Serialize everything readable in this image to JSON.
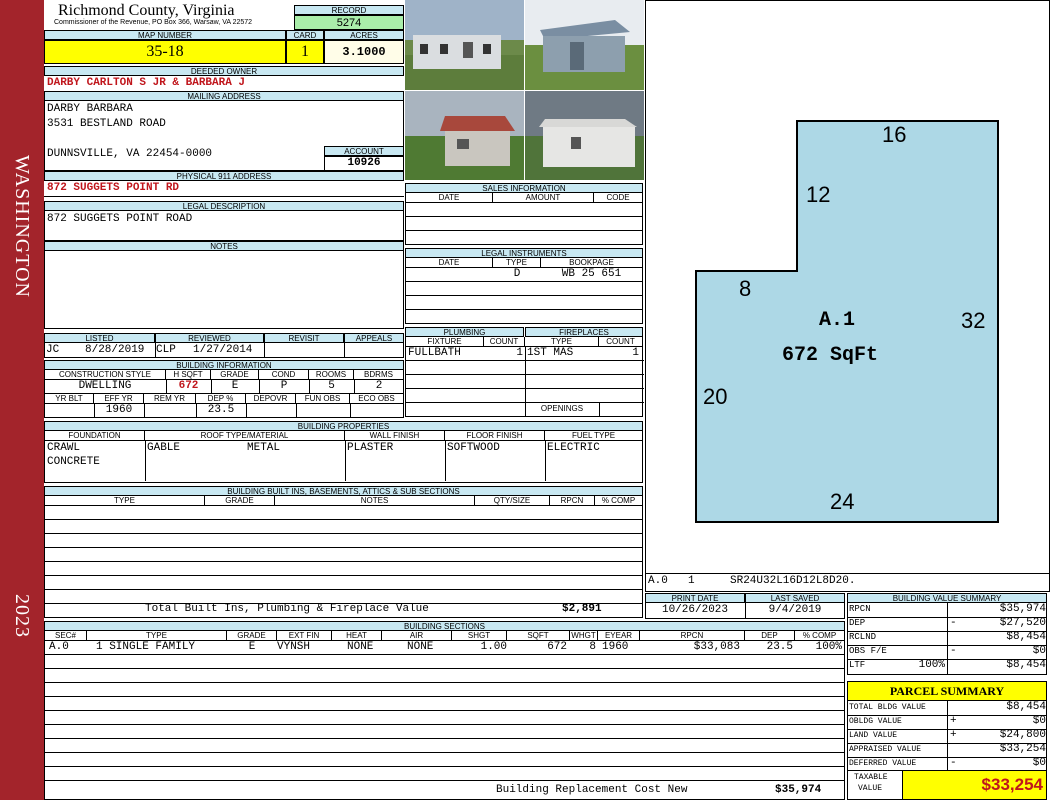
{
  "sidebar": {
    "top_text": "WASHINGTON",
    "bottom_text": "2023"
  },
  "header": {
    "county": "Richmond County, Virginia",
    "commissioner": "Commissioner of the Revenue, PO Box 366, Warsaw, VA 22572",
    "record_label": "RECORD",
    "record": "5274",
    "map_label": "MAP NUMBER",
    "map_number": "35-18",
    "card_label": "CARD",
    "card": "1",
    "acres_label": "ACRES",
    "acres": "3.1000"
  },
  "owner": {
    "deeded_label": "DEEDED OWNER",
    "deeded": "DARBY CARLTON S JR & BARBARA J",
    "mailing_label": "MAILING ADDRESS",
    "mailing_lines": [
      "DARBY BARBARA",
      "3531 BESTLAND ROAD",
      "",
      "DUNNSVILLE, VA 22454-0000"
    ],
    "account_label": "ACCOUNT",
    "account": "10926",
    "physical_label": "PHYSICAL 911 ADDRESS",
    "physical": "872 SUGGETS POINT RD",
    "legal_label": "LEGAL DESCRIPTION",
    "legal": "872 SUGGETS POINT ROAD",
    "notes_label": "NOTES"
  },
  "review": {
    "listed_label": "LISTED",
    "listed_by": "JC",
    "listed_date": "8/28/2019",
    "reviewed_label": "REVIEWED",
    "reviewed_by": "CLP",
    "reviewed_date": "1/27/2014",
    "revisit_label": "REVISIT",
    "appeals_label": "APPEALS"
  },
  "building_info": {
    "label": "BUILDING INFORMATION",
    "headers": [
      "CONSTRUCTION STYLE",
      "H SQFT",
      "GRADE",
      "COND",
      "ROOMS",
      "BDRMS"
    ],
    "values": [
      "DWELLING",
      "672",
      "E",
      "P",
      "5",
      "2"
    ],
    "headers2": [
      "YR BLT",
      "EFF YR",
      "REM YR",
      "DEP %",
      "DEPOVR",
      "FUN OBS",
      "ECO OBS"
    ],
    "values2": [
      "",
      "1960",
      "",
      "23.5",
      "",
      "",
      ""
    ]
  },
  "sales": {
    "label": "SALES INFORMATION",
    "headers": [
      "DATE",
      "AMOUNT",
      "CODE"
    ]
  },
  "legal_instruments": {
    "label": "LEGAL INSTRUMENTS",
    "headers": [
      "DATE",
      "TYPE",
      "BOOKPAGE"
    ],
    "rows": [
      [
        "",
        "D",
        "WB 25 651"
      ]
    ]
  },
  "plumbing": {
    "label": "PLUMBING",
    "headers": [
      "FIXTURE",
      "COUNT"
    ],
    "rows": [
      [
        "FULLBATH",
        "1"
      ]
    ]
  },
  "fireplaces": {
    "label": "FIREPLACES",
    "headers": [
      "TYPE",
      "COUNT"
    ],
    "rows": [
      [
        "1ST MAS",
        "1"
      ]
    ],
    "openings_label": "OPENINGS"
  },
  "properties": {
    "label": "BUILDING PROPERTIES",
    "headers": [
      "FOUNDATION",
      "ROOF TYPE/MATERIAL",
      "WALL FINISH",
      "FLOOR FINISH",
      "FUEL TYPE"
    ],
    "foundation": [
      "CRAWL",
      "CONCRETE"
    ],
    "roof_type": "GABLE",
    "roof_material": "METAL",
    "wall": "PLASTER",
    "floor": "SOFTWOOD",
    "fuel": "ELECTRIC"
  },
  "builtins": {
    "label": "BUILDING BUILT INS, BASEMENTS, ATTICS & SUB SECTIONS",
    "headers": [
      "TYPE",
      "GRADE",
      "NOTES",
      "QTY/SIZE",
      "RPCN",
      "% COMP"
    ],
    "total_label": "Total Built Ins, Plumbing & Fireplace Value",
    "total": "$2,891"
  },
  "sketch": {
    "labels": [
      "16",
      "12",
      "8",
      "32",
      "20",
      "24"
    ],
    "section": "A.1",
    "area": "672 SqFt",
    "footer_sec": "A.0",
    "footer_card": "1",
    "footer_code": "SR24U32L16D12L8D20."
  },
  "dates": {
    "print_label": "PRINT DATE",
    "print": "10/26/2023",
    "saved_label": "LAST SAVED",
    "saved": "9/4/2019"
  },
  "sections": {
    "label": "BUILDING SECTIONS",
    "headers": [
      "SEC#",
      "TYPE",
      "GRADE",
      "EXT FIN",
      "HEAT",
      "AIR",
      "SHGT",
      "SQFT",
      "WHGT",
      "EYEAR",
      "RPCN",
      "DEP",
      "% COMP"
    ],
    "row": [
      "A.0",
      "1 SINGLE FAMILY",
      "E",
      "VYNSH",
      "NONE",
      "NONE",
      "1.00",
      "672",
      "8",
      "1960",
      "$33,083",
      "23.5",
      "100%"
    ],
    "replacement_label": "Building Replacement Cost New",
    "replacement": "$35,974"
  },
  "value_summary": {
    "label": "BUILDING VALUE SUMMARY",
    "rows": [
      {
        "label": "RPCN",
        "sign": "",
        "value": "$35,974"
      },
      {
        "label": "DEP",
        "sign": "-",
        "value": "$27,520"
      },
      {
        "label": "RCLND",
        "sign": "",
        "value": "$8,454"
      },
      {
        "label": "OBS F/E",
        "sign": "-",
        "value": "$0"
      },
      {
        "label": "LTF",
        "sign": "100%",
        "value": "$8,454"
      }
    ]
  },
  "parcel": {
    "label": "PARCEL SUMMARY",
    "rows": [
      {
        "label": "TOTAL BLDG VALUE",
        "sign": "",
        "value": "$8,454"
      },
      {
        "label": "OBLDG VALUE",
        "sign": "+",
        "value": "$0"
      },
      {
        "label": "LAND VALUE",
        "sign": "+",
        "value": "$24,800"
      },
      {
        "label": "APPRAISED VALUE",
        "sign": "",
        "value": "$33,254"
      },
      {
        "label": "DEFERRED VALUE",
        "sign": "-",
        "value": "$0"
      }
    ],
    "taxable_label_1": "TAXABLE",
    "taxable_label_2": "VALUE",
    "taxable": "$33,254"
  }
}
